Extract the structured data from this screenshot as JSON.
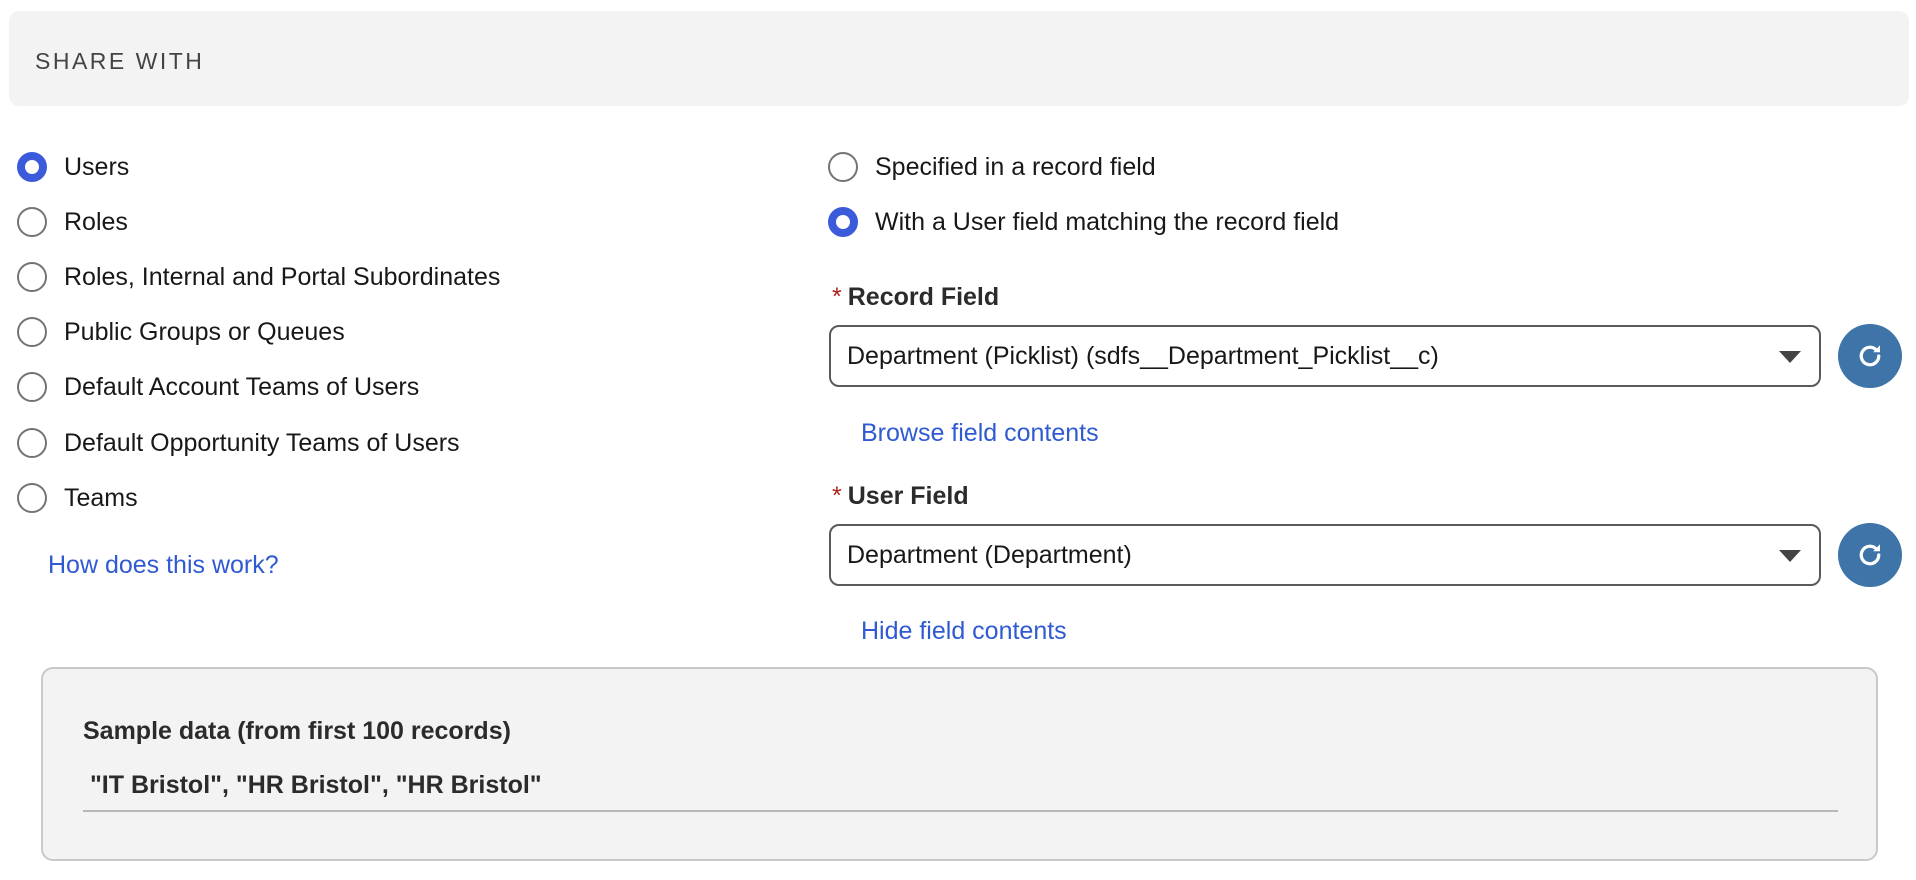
{
  "header": {
    "title": "SHARE WITH"
  },
  "share_types": [
    {
      "label": "Users",
      "checked": true
    },
    {
      "label": "Roles",
      "checked": false
    },
    {
      "label": "Roles, Internal and Portal Subordinates",
      "checked": false
    },
    {
      "label": "Public Groups or Queues",
      "checked": false
    },
    {
      "label": "Default Account Teams of Users",
      "checked": false
    },
    {
      "label": "Default Opportunity Teams of Users",
      "checked": false
    },
    {
      "label": "Teams",
      "checked": false
    }
  ],
  "help_link": "How does this work?",
  "user_options": [
    {
      "label": "Specified in a record field",
      "checked": false
    },
    {
      "label": "With a User field matching the record field",
      "checked": true
    }
  ],
  "record_field": {
    "required_marker": "*",
    "label": "Record Field",
    "value": "Department (Picklist) (sdfs__Department_Picklist__c)",
    "link": "Browse field contents"
  },
  "user_field": {
    "required_marker": "*",
    "label": "User Field",
    "value": "Department (Department)",
    "link": "Hide field contents"
  },
  "sample": {
    "title": "Sample data (from first 100 records)",
    "values": " \"IT Bristol\", \"HR Bristol\", \"HR Bristol\""
  },
  "colors": {
    "accent": "#3b5bdb",
    "link": "#2f5ad1",
    "refresh_button": "#3e74a8",
    "required": "#b0221a"
  },
  "icons": {
    "refresh": "refresh-icon",
    "dropdown": "chevron-down-icon"
  }
}
